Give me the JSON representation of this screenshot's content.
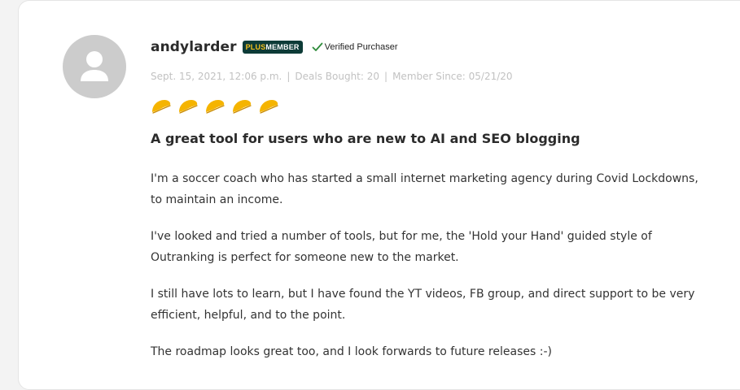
{
  "review": {
    "username": "andylarder",
    "badge": {
      "plus": "PLUS",
      "member": "MEMBER"
    },
    "verified_label": "Verified Purchaser",
    "meta": {
      "date": "Sept. 15, 2021, 12:06 p.m.",
      "separator": "|",
      "deals_bought": "Deals Bought: 20",
      "member_since": "Member Since: 05/21/20"
    },
    "rating": {
      "value": 5,
      "max": 5,
      "icon": "taco-icon"
    },
    "title": "A great tool for users who are new to AI and SEO blogging",
    "paragraphs": [
      "I'm a soccer coach who has started a small internet marketing agency during Covid Lockdowns, to maintain an income.",
      "I've looked and tried a number of tools, but for me, the 'Hold your Hand' guided style of Outranking is perfect for someone new to the market.",
      "I still have lots to learn, but I have found the YT videos, FB group, and direct support to be very efficient, helpful, and to the point.",
      "The roadmap looks great too, and I look forwards to future releases :-)"
    ]
  },
  "colors": {
    "badge_bg": "#0d3b37",
    "badge_plus": "#f4c11c",
    "verified_check": "#2e8b3a",
    "taco": "#f5b400",
    "avatar_bg": "#cccccc"
  }
}
